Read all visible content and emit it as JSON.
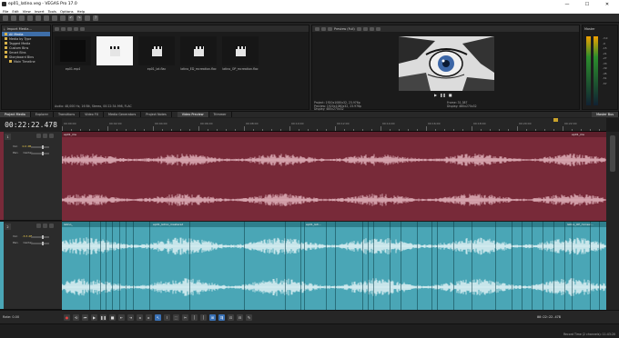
{
  "window": {
    "title": "ep01_latino.veg - VEGAS Pro 17.0",
    "buttons": [
      "—",
      "☐",
      "✕"
    ]
  },
  "menu": [
    "File",
    "Edit",
    "View",
    "Insert",
    "Tools",
    "Options",
    "Help"
  ],
  "project_media": {
    "header": "Import Media...",
    "tree": [
      "All Media",
      "Media by Type",
      "Tagged Media",
      "Custom Bins",
      "Smart Bins",
      "Storyboard Bins",
      "Main Timeline"
    ],
    "thumbs": [
      {
        "caption": "ep01.mp4",
        "kind": "film"
      },
      {
        "caption": "",
        "kind": "clap-selected"
      },
      {
        "caption": "ep01_lat.flac",
        "kind": "clap"
      },
      {
        "caption": "latino_ED_mcreation.flac",
        "kind": "clap"
      },
      {
        "caption": "latino_OP_mcreation.flac",
        "kind": "clap"
      }
    ],
    "status": "Audio: 48,000 Hz, 16 Bit, Stereo, 00:22:34.998, FLAC"
  },
  "preview": {
    "mode": "Preview (Full)",
    "info_left": [
      "Project: 1920x1080x32, 23.976p",
      "Preview: 1920x1080x32, 23.976p",
      "Display: 480x270x32"
    ],
    "info_right": [
      "Frame: 31,387",
      "Display: 480x270x32"
    ],
    "tabs": [
      "Video Preview",
      "Trimmer"
    ]
  },
  "master": {
    "label": "Master",
    "scale": [
      "-3.0",
      "-6",
      "-9",
      "-12",
      "-15",
      "-18",
      "-21",
      "-24",
      "-27",
      "-30",
      "-33",
      "-36",
      "-39",
      "-42",
      "-45",
      "-48",
      "-51",
      "-54",
      "-57"
    ],
    "tab": "Master Bus"
  },
  "tabs": [
    "Project Media",
    "Explorer",
    "Transitions",
    "Video FX",
    "Media Generators",
    "Project Notes"
  ],
  "timeline": {
    "timecode": "00:22:22.478",
    "ruler_labels": [
      "00:00:00",
      "00:02:00",
      "00:04:00",
      "00:06:00",
      "00:08:00",
      "00:10:00",
      "00:12:00",
      "00:14:00",
      "00:16:00",
      "00:18:00",
      "00:20:00",
      "00:22:00"
    ],
    "track1": {
      "num": "1",
      "vol_label": "Vol:",
      "vol": "0.0 dB",
      "pan_label": "Pan:",
      "pan": "Center",
      "clip": "ep01_me",
      "clip_end": "ep01_me"
    },
    "track2": {
      "num": "2",
      "vol_label": "Vol:",
      "vol": "-5.5 dB",
      "pan_label": "Pan:",
      "pan": "Center",
      "clip": "latino_",
      "clip2": "ep01_latino_mastered",
      "clip3": "ep01_lati...",
      "clip4": "latino_OP_mcreat..."
    },
    "rate": "Rate: 0.00",
    "end_timecode": "00:22:22.478"
  },
  "status": {
    "record": "Record Time (2 channels): 11:43:20"
  },
  "colors": {
    "track1": "#782a39",
    "track2": "#4aa6b6",
    "accent": "#3a71b5"
  }
}
